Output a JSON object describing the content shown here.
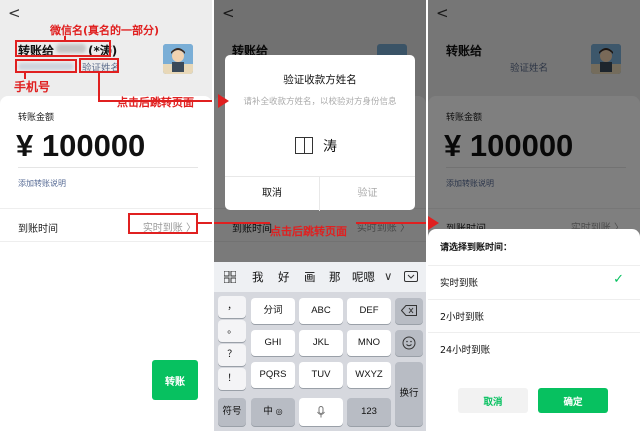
{
  "colors": {
    "accent_green": "#07c160",
    "annotation_red": "#e02020",
    "link_blue": "#576b95"
  },
  "screen": {
    "back_icon": "chevron-left-icon",
    "to_label": "转账给",
    "name_suffix": "(*涛)",
    "verify_name_link": "验证姓名",
    "amount_label": "转账金额",
    "amount": "¥ 100000",
    "add_note": "添加转账说明",
    "arrival_label": "到账时间",
    "arrival_value": "实时到账 〉",
    "transfer_button": "转账"
  },
  "annotations": {
    "wechat_name": "微信名(真名的一部分)",
    "phone": "手机号",
    "jump1": "点击后跳转页面",
    "jump2": "点击后跳转页面"
  },
  "dialog": {
    "title": "验证收款方姓名",
    "description": "请补全收款方姓名，以校验对方身份信息",
    "entered_char": "涛",
    "cancel": "取消",
    "confirm": "验证"
  },
  "keyboard": {
    "candidates": [
      "我",
      "好",
      "画",
      "那",
      "呢嗯"
    ],
    "grid_icon": "grid-icon",
    "collapse_icon": "keyboard-collapse-icon",
    "left_column": [
      "，",
      "。",
      "？",
      "！"
    ],
    "keys": [
      "分词",
      "ABC",
      "DEF",
      "GHI",
      "JKL",
      "MNO",
      "PQRS",
      "TUV",
      "WXYZ"
    ],
    "backspace_icon": "backspace-icon",
    "emoji_icon": "smiley-icon",
    "enter": "换行",
    "symbols": "符号",
    "chinese": "中",
    "globe_icon": "globe-icon",
    "mic_icon": "microphone-icon",
    "digits": "123"
  },
  "sheet": {
    "title": "请选择到账时间：",
    "options": [
      "实时到账",
      "2小时到账",
      "24小时到账"
    ],
    "selected_index": 0,
    "check_icon": "checkmark-icon",
    "cancel": "取消",
    "confirm": "确定"
  }
}
